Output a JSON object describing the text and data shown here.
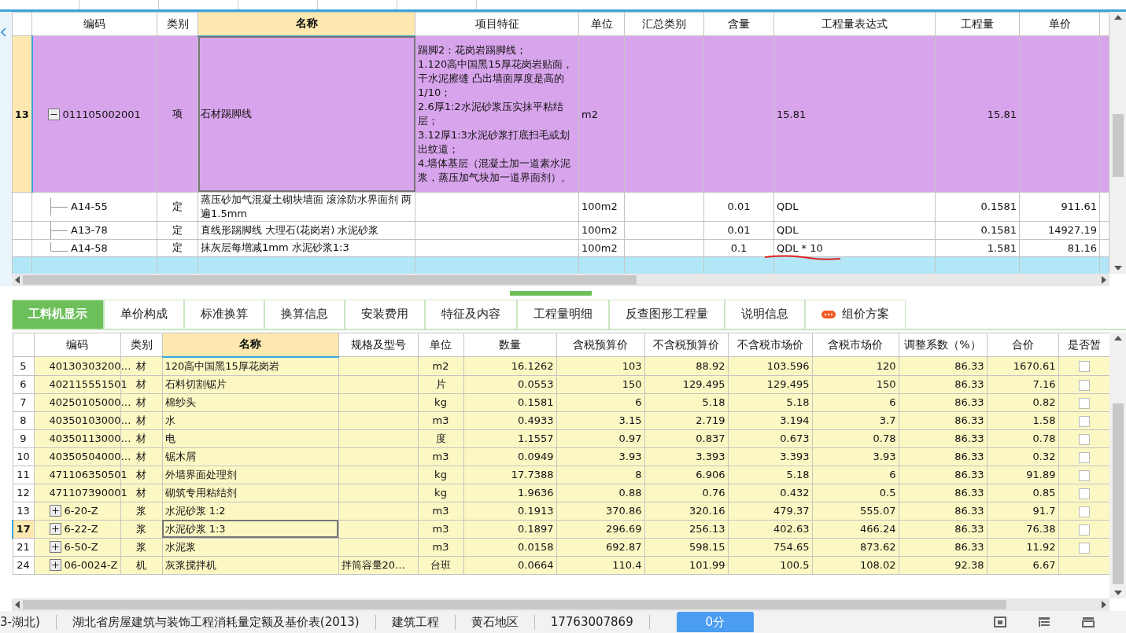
{
  "top_table": {
    "columns": [
      {
        "label": "编码",
        "selected": false
      },
      {
        "label": "类别",
        "selected": false
      },
      {
        "label": "名称",
        "selected": true
      },
      {
        "label": "项目特征",
        "selected": false
      },
      {
        "label": "单位",
        "selected": false
      },
      {
        "label": "汇总类别",
        "selected": false
      },
      {
        "label": "含量",
        "selected": false
      },
      {
        "label": "工程量表达式",
        "selected": false
      },
      {
        "label": "工程量",
        "selected": false
      },
      {
        "label": "单价",
        "selected": false
      }
    ],
    "rows": [
      {
        "num": "13",
        "code": "011105002001",
        "type": "项",
        "name": "石材踢脚线",
        "feature": "踢脚2：花岗岩踢脚线；\n1.120高中国黑15厚花岗岩贴面，干水泥擦缝 凸出墙面厚度是高的1/10；\n2.6厚1:2水泥砂浆压实抹平粘结层；\n3.12厚1:3水泥砂浆打底扫毛或划出纹道；\n4.墙体基层（混凝土加一道素水泥浆，蒸压加气块加一道界面剂）。",
        "unit": "m2",
        "expression": "15.81",
        "quantity": "15.81",
        "color": "#d8a5ec",
        "selected": true,
        "expanded": true,
        "children": [
          {
            "code": "A14-55",
            "type": "定",
            "name": "蒸压砂加气混凝土砌块墙面 滚涂防水界面剂 两遍1.5mm",
            "unit": "100m2",
            "content": "0.01",
            "expression": "QDL",
            "quantity": "0.1581",
            "price": "911.61",
            "marked": false
          },
          {
            "code": "A13-78",
            "type": "定",
            "name": "直线形踢脚线 大理石(花岗岩) 水泥砂浆",
            "unit": "100m2",
            "content": "0.01",
            "expression": "QDL",
            "quantity": "0.1581",
            "price": "14927.19",
            "marked": false
          },
          {
            "code": "A14-58",
            "type": "定",
            "name": "抹灰层每增减1mm 水泥砂浆1:3",
            "unit": "100m2",
            "content": "0.1",
            "expression": "QDL * 10",
            "quantity": "1.581",
            "price": "81.16",
            "marked": true
          }
        ]
      },
      {
        "color": "#b2e7f8",
        "selected": false
      }
    ]
  },
  "tabs": [
    {
      "label": "工料机显示",
      "selected": true,
      "badge": false
    },
    {
      "label": "单价构成",
      "selected": false,
      "badge": false
    },
    {
      "label": "标准换算",
      "selected": false,
      "badge": false
    },
    {
      "label": "换算信息",
      "selected": false,
      "badge": false
    },
    {
      "label": "安装费用",
      "selected": false,
      "badge": false
    },
    {
      "label": "特征及内容",
      "selected": false,
      "badge": false
    },
    {
      "label": "工程量明细",
      "selected": false,
      "badge": false
    },
    {
      "label": "反查图形工程量",
      "selected": false,
      "badge": false
    },
    {
      "label": "说明信息",
      "selected": false,
      "badge": false
    },
    {
      "label": "组价方案",
      "selected": false,
      "badge": true
    }
  ],
  "bottom_table": {
    "columns": [
      {
        "label": "编码",
        "selected": false
      },
      {
        "label": "类别",
        "selected": false
      },
      {
        "label": "名称",
        "selected": true
      },
      {
        "label": "规格及型号",
        "selected": false
      },
      {
        "label": "单位",
        "selected": false
      },
      {
        "label": "数量",
        "selected": false
      },
      {
        "label": "含税预算价",
        "selected": false
      },
      {
        "label": "不含税预算价",
        "selected": false
      },
      {
        "label": "不含税市场价",
        "selected": false
      },
      {
        "label": "含税市场价",
        "selected": false
      },
      {
        "label": "调整系数（%）",
        "selected": false
      },
      {
        "label": "合价",
        "selected": false
      },
      {
        "label": "是否暂",
        "selected": false
      }
    ],
    "rows": [
      {
        "num": "5",
        "code": "40130303200…",
        "type": "材",
        "name": "120高中国黑15厚花岗岩",
        "unit": "m2",
        "qty": "16.1262",
        "p1": "103",
        "p2": "88.92",
        "p3": "103.596",
        "p4": "120",
        "factor": "86.33",
        "total": "1670.61",
        "checked": false,
        "selected": false
      },
      {
        "num": "6",
        "code": "402115551501",
        "type": "材",
        "name": "石料切割锯片",
        "unit": "片",
        "qty": "0.0553",
        "p1": "150",
        "p2": "129.495",
        "p3": "129.495",
        "p4": "150",
        "factor": "86.33",
        "total": "7.16",
        "checked": false,
        "selected": false
      },
      {
        "num": "7",
        "code": "40250105000…",
        "type": "材",
        "name": "棉纱头",
        "unit": "kg",
        "qty": "0.1581",
        "p1": "6",
        "p2": "5.18",
        "p3": "5.18",
        "p4": "6",
        "factor": "86.33",
        "total": "0.82",
        "checked": false,
        "selected": false
      },
      {
        "num": "8",
        "code": "40350103000…",
        "type": "材",
        "name": "水",
        "unit": "m3",
        "qty": "0.4933",
        "p1": "3.15",
        "p2": "2.719",
        "p3": "3.194",
        "p4": "3.7",
        "factor": "86.33",
        "total": "1.58",
        "checked": false,
        "selected": false
      },
      {
        "num": "9",
        "code": "40350113000…",
        "type": "材",
        "name": "电",
        "unit": "度",
        "qty": "1.1557",
        "p1": "0.97",
        "p2": "0.837",
        "p3": "0.673",
        "p4": "0.78",
        "factor": "86.33",
        "total": "0.78",
        "checked": false,
        "selected": false
      },
      {
        "num": "10",
        "code": "40350504000…",
        "type": "材",
        "name": "锯木屑",
        "unit": "m3",
        "qty": "0.0949",
        "p1": "3.93",
        "p2": "3.393",
        "p3": "3.393",
        "p4": "3.93",
        "factor": "86.33",
        "total": "0.32",
        "checked": false,
        "selected": false
      },
      {
        "num": "11",
        "code": "471106350501",
        "type": "材",
        "name": "外墙界面处理剂",
        "unit": "kg",
        "qty": "17.7388",
        "p1": "8",
        "p2": "6.906",
        "p3": "5.18",
        "p4": "6",
        "factor": "86.33",
        "total": "91.89",
        "checked": false,
        "selected": false
      },
      {
        "num": "12",
        "code": "471107390001",
        "type": "材",
        "name": "砌筑专用粘结剂",
        "unit": "kg",
        "qty": "1.9636",
        "p1": "0.88",
        "p2": "0.76",
        "p3": "0.432",
        "p4": "0.5",
        "factor": "86.33",
        "total": "0.85",
        "checked": false,
        "selected": false
      },
      {
        "num": "13",
        "code": "6-20-Z",
        "expanded": false,
        "type": "浆",
        "name": "水泥砂浆 1:2",
        "unit": "m3",
        "qty": "0.1913",
        "p1": "370.86",
        "p2": "320.16",
        "p3": "479.37",
        "p4": "555.07",
        "factor": "86.33",
        "total": "91.7",
        "checked": false,
        "selected": false
      },
      {
        "num": "17",
        "code": "6-22-Z",
        "expanded": false,
        "type": "浆",
        "name": "水泥砂浆 1:3",
        "unit": "m3",
        "qty": "0.1897",
        "p1": "296.69",
        "p2": "256.13",
        "p3": "402.63",
        "p4": "466.24",
        "factor": "86.33",
        "total": "76.38",
        "checked": false,
        "selected": true
      },
      {
        "num": "21",
        "code": "6-50-Z",
        "expanded": false,
        "type": "浆",
        "name": "水泥浆",
        "unit": "m3",
        "qty": "0.0158",
        "p1": "692.87",
        "p2": "598.15",
        "p3": "754.65",
        "p4": "873.62",
        "factor": "86.33",
        "total": "11.92",
        "checked": false,
        "selected": false
      },
      {
        "num": "24",
        "code": "06-0024-Z",
        "expanded": false,
        "type": "机",
        "name": "灰浆搅拌机",
        "spec": "拌筒容量20…",
        "unit": "台班",
        "qty": "0.0664",
        "p1": "110.4",
        "p2": "101.99",
        "p3": "100.5",
        "p4": "108.02",
        "factor": "92.38",
        "total": "6.67",
        "selected": false
      }
    ]
  },
  "status_bar": {
    "items": [
      "3-湖北)",
      "湖北省房屋建筑与装饰工程消耗量定额及基价表(2013)",
      "建筑工程",
      "黄石地区",
      "17763007869"
    ],
    "button": "0分"
  }
}
